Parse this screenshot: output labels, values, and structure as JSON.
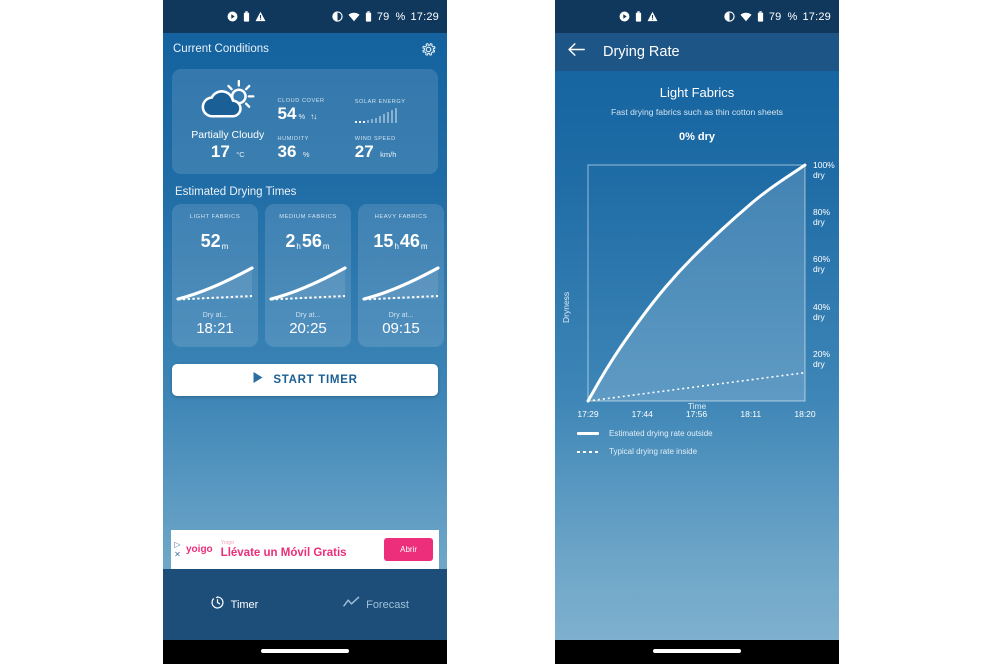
{
  "status_bar": {
    "icons_left": [
      "play-circle-icon",
      "battery-saver-icon",
      "warning-triangle-icon"
    ],
    "icons_right": [
      "brightness-icon",
      "wifi-icon",
      "battery-icon"
    ],
    "battery_percent": "79",
    "percent_symbol": "%",
    "clock": "17:29"
  },
  "left_screen": {
    "header": {
      "title": "Current Conditions",
      "settings_icon": "gear-icon"
    },
    "weather": {
      "condition_icon": "partly-cloudy-icon",
      "condition": "Partially Cloudy",
      "temperature": "17",
      "temperature_unit": "°C",
      "cloud_cover_label": "CLOUD COVER",
      "cloud_cover_value": "54",
      "cloud_cover_unit": "%",
      "cloud_cover_trend": "↑↓",
      "solar_energy_label": "SOLAR ENERGY",
      "solar_energy_bars": [
        2,
        2,
        2,
        3,
        4,
        5,
        7,
        9,
        11,
        13,
        15
      ],
      "solar_energy_filled": 3,
      "humidity_label": "HUMIDITY",
      "humidity_value": "36",
      "humidity_unit": "%",
      "wind_label": "WIND SPEED",
      "wind_value": "27",
      "wind_unit": "km/h"
    },
    "drying_section_title": "Estimated Drying Times",
    "fabrics": [
      {
        "label": "LIGHT FABRICS",
        "value_main": "52",
        "unit_main": "m",
        "value_second": "",
        "unit_second": "",
        "dry_at_label": "Dry at...",
        "dry_at_time": "18:21"
      },
      {
        "label": "MEDIUM FABRICS",
        "value_main": "2",
        "unit_main": "h",
        "value_second": "56",
        "unit_second": "m",
        "dry_at_label": "Dry at...",
        "dry_at_time": "20:25"
      },
      {
        "label": "HEAVY FABRICS",
        "value_main": "15",
        "unit_main": "h",
        "value_second": "46",
        "unit_second": "m",
        "dry_at_label": "Dry at...",
        "dry_at_time": "09:15"
      }
    ],
    "start_button": {
      "label": "START TIMER",
      "icon": "play-icon"
    },
    "ad": {
      "brand": "yoigo",
      "sub": "Yoigo",
      "title": "Llévate un Móvil Gratis",
      "cta": "Abrir",
      "marks": [
        "▷",
        "✕"
      ]
    },
    "bottom_nav": [
      {
        "label": "Timer",
        "icon": "timer-icon",
        "active": true
      },
      {
        "label": "Forecast",
        "icon": "forecast-chart-icon",
        "active": false
      }
    ]
  },
  "right_screen": {
    "appbar": {
      "back_icon": "arrow-left-icon",
      "title": "Drying Rate"
    },
    "fabric_title": "Light Fabrics",
    "fabric_sub": "Fast drying fabrics such as thin cotton sheets",
    "dry_percent": "0% dry",
    "legend": [
      {
        "label": "Estimated drying rate outside",
        "style": "solid"
      },
      {
        "label": "Typical drying rate inside",
        "style": "dotted"
      }
    ],
    "chart_data": {
      "type": "line",
      "title": "Light Fabrics",
      "xlabel": "Time",
      "ylabel": "Dryness",
      "x": [
        "17:29",
        "17:44",
        "17:56",
        "18:11",
        "18:20"
      ],
      "xticks": [
        "17:29",
        "17:44",
        "17:56",
        "18:11",
        "18:20"
      ],
      "yticks": [
        "20%\ndry",
        "40%\ndry",
        "60%\ndry",
        "80%\ndry",
        "100%\ndry"
      ],
      "ytick_values": [
        20,
        40,
        60,
        80,
        100
      ],
      "ylim": [
        0,
        100
      ],
      "grid": false,
      "legend_position": "below",
      "series": [
        {
          "name": "Estimated drying rate outside",
          "style": "solid",
          "x": [
            0,
            0.08,
            0.18,
            0.3,
            0.42,
            0.55,
            0.68,
            0.82,
            1.0
          ],
          "values": [
            0,
            13,
            27,
            42,
            55,
            67,
            78,
            89,
            100
          ]
        },
        {
          "name": "Typical drying rate inside",
          "style": "dotted",
          "x": [
            0,
            0.25,
            0.5,
            0.75,
            1.0
          ],
          "values": [
            0,
            3,
            6,
            9,
            12
          ]
        }
      ]
    }
  },
  "colors": {
    "screen_top": "#11609d",
    "screen_bottom": "#7fb0ce",
    "status_bar": "#10385c",
    "appbar": "#1d5586",
    "nav_bar": "#1d4e7a",
    "accent_white": "#ffffff",
    "ad_pink": "#ec2e7b",
    "button_text": "#1b5f93"
  }
}
